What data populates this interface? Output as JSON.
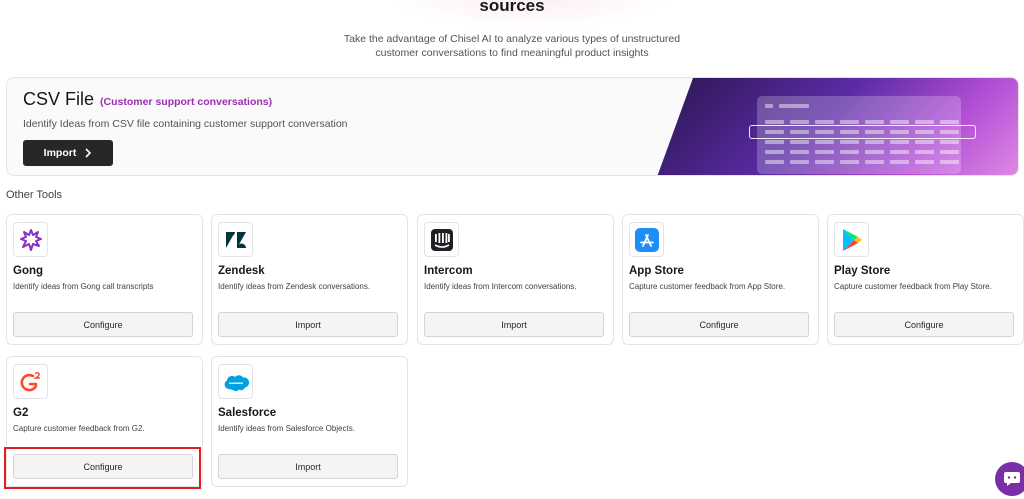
{
  "hero": {
    "title": "sources",
    "subtitle_line1": "Take the advantage of Chisel AI to analyze various types of unstructured",
    "subtitle_line2": "customer conversations to find meaningful product insights"
  },
  "csv": {
    "title": "CSV File",
    "tag": "(Customer support conversations)",
    "description": "Identify Ideas from CSV file containing customer support conversation",
    "import_label": "Import",
    "import_icon": "chevron-right-icon"
  },
  "other_tools": {
    "label": "Other Tools",
    "cards": [
      {
        "name": "Gong",
        "description": "Identify ideas from Gong call transcripts",
        "button": "Configure",
        "icon": "gong-icon"
      },
      {
        "name": "Zendesk",
        "description": "Identify ideas from Zendesk conversations.",
        "button": "Import",
        "icon": "zendesk-icon"
      },
      {
        "name": "Intercom",
        "description": "Identify ideas from Intercom conversations.",
        "button": "Import",
        "icon": "intercom-icon"
      },
      {
        "name": "App Store",
        "description": "Capture customer feedback from App Store.",
        "button": "Configure",
        "icon": "app-store-icon"
      },
      {
        "name": "Play Store",
        "description": "Capture customer feedback from Play Store.",
        "button": "Configure",
        "icon": "play-store-icon"
      },
      {
        "name": "G2",
        "description": "Capture customer feedback from G2.",
        "button": "Configure",
        "icon": "g2-icon"
      },
      {
        "name": "Salesforce",
        "description": "Identify ideas from Salesforce Objects.",
        "button": "Import",
        "icon": "salesforce-icon"
      }
    ]
  },
  "colors": {
    "accent_purple": "#9b2fb0",
    "highlight_red": "#e11d24",
    "chat_fab": "#7a2fa8"
  },
  "chat_widget": {
    "icon": "chat-bubble-icon"
  }
}
